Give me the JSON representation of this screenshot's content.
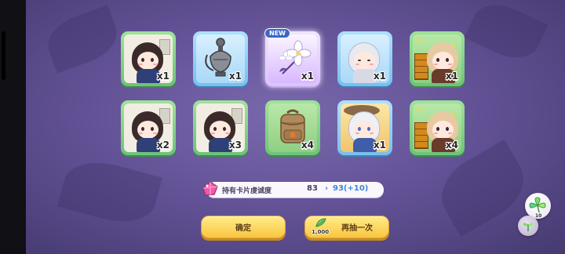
{
  "new_badge": "NEW",
  "cards_row1": [
    {
      "name": "girl-dark-hair",
      "qty": "x1"
    },
    {
      "name": "censer",
      "qty": "x1"
    },
    {
      "name": "white-flower",
      "qty": "x1"
    },
    {
      "name": "girl-white-hair-sleeping",
      "qty": "x1"
    },
    {
      "name": "girl-blonde-braids",
      "qty": "x1"
    }
  ],
  "cards_row2": [
    {
      "name": "girl-dark-hair",
      "qty": "x2"
    },
    {
      "name": "girl-dark-hair",
      "qty": "x3"
    },
    {
      "name": "backpack",
      "qty": "x4"
    },
    {
      "name": "girl-white-hair-hat",
      "qty": "x1"
    },
    {
      "name": "girl-blonde-braids",
      "qty": "x4"
    }
  ],
  "affection": {
    "label": "持有卡片虔诚度",
    "current": "83",
    "arrow": "›",
    "result": "93(+10)"
  },
  "buttons": {
    "confirm": "确定",
    "redraw": "再抽一次",
    "redraw_cost": "1,000"
  },
  "side": {
    "count": "10"
  },
  "colors": {
    "card_green": "#6cc37a",
    "card_blue": "#78bff0",
    "card_purple": "#d9c3ff",
    "button_yellow": "#f9c640",
    "background": "#5f4f92"
  }
}
